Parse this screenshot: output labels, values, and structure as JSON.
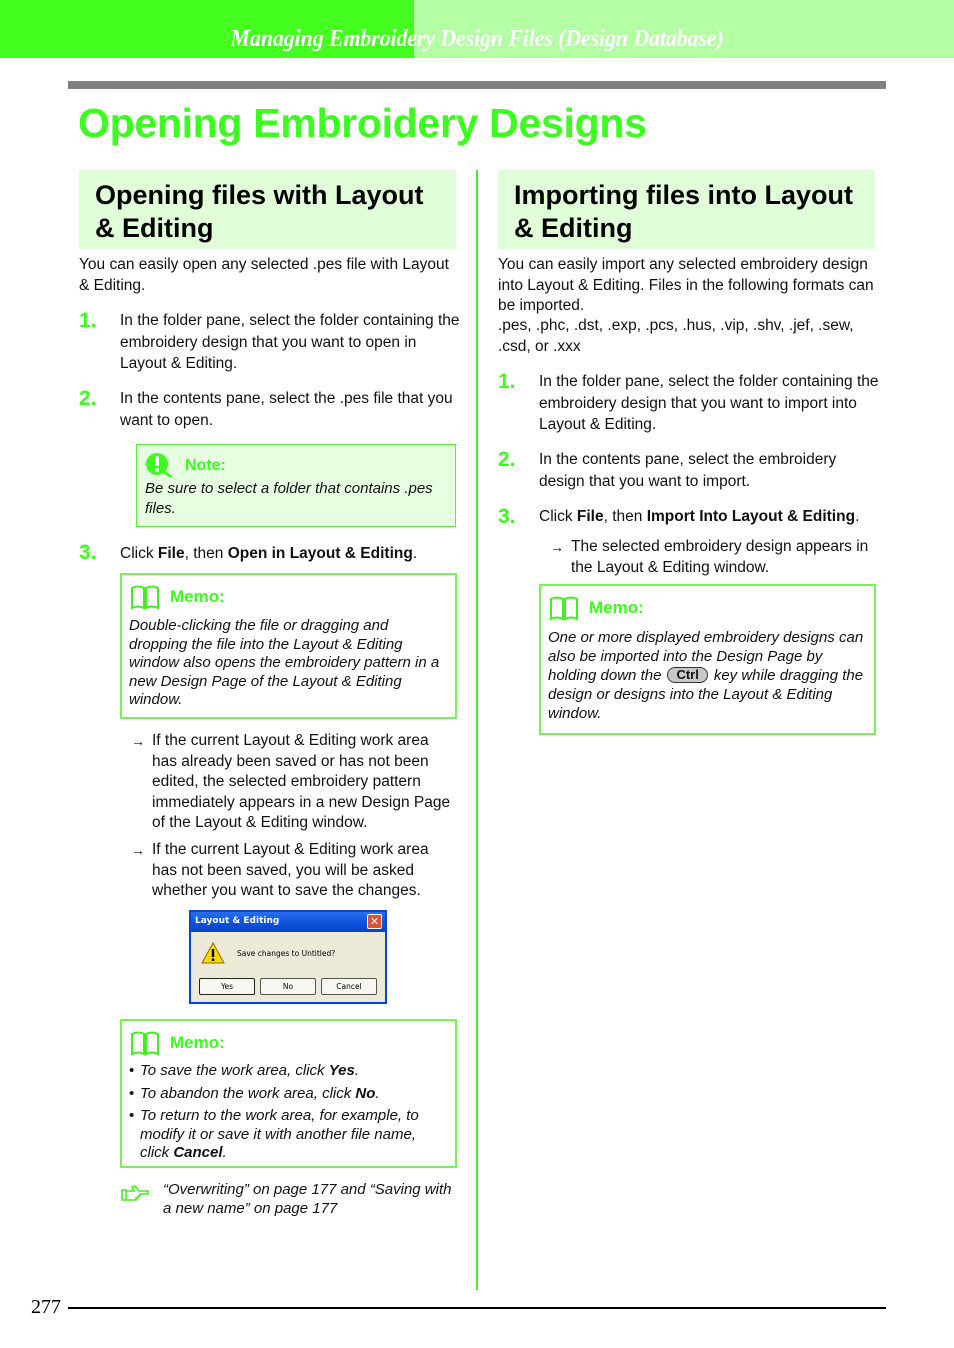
{
  "header": {
    "chapter_title": "Managing Embroidery Design Files (Design Database)",
    "colors": {
      "bright_green": "#44ff1f",
      "light_green": "#b4ffa4"
    }
  },
  "page_title": "Opening Embroidery Designs",
  "left": {
    "heading": "Opening files with Layout & Editing",
    "intro": "You can easily open any selected .pes file with Layout & Editing.",
    "steps": [
      {
        "num": "1.",
        "text": "In the folder pane, select the folder containing the embroidery design that you want to open in Layout & Editing."
      },
      {
        "num": "2.",
        "text": "In the contents pane, select the .pes file that you want to open."
      },
      {
        "num": "3.",
        "text_prefix": "Click ",
        "bold1": "File",
        "text_mid": ", then ",
        "bold2": "Open in Layout & Editing",
        "text_suffix": "."
      }
    ],
    "note": {
      "label": "Note:",
      "text": "Be sure to select a folder that contains .pes files."
    },
    "memo1": {
      "label": "Memo:",
      "text": "Double-clicking the file or dragging and dropping the file into the Layout & Editing window also opens the embroidery pattern in a new Design Page of the Layout & Editing window."
    },
    "results": [
      "If the current Layout & Editing work area has already been saved or has not been edited, the selected embroidery pattern immediately appears in a new Design Page of the Layout & Editing window.",
      "If the current Layout & Editing work area has not been saved, you will be asked whether you want to save the changes."
    ],
    "dialog": {
      "title": "Layout & Editing",
      "message": "Save changes to Untitled?",
      "buttons": [
        "Yes",
        "No",
        "Cancel"
      ]
    },
    "memo2": {
      "label": "Memo:",
      "bullets": [
        {
          "pre": "To save the work area, click ",
          "bold": "Yes",
          "post": "."
        },
        {
          "pre": "To abandon the work area, click ",
          "bold": "No",
          "post": "."
        },
        {
          "pre": "To return to the work area, for example, to modify it or save it with another file name, click ",
          "bold": "Cancel",
          "post": "."
        }
      ]
    },
    "reference": "“Overwriting” on page 177 and “Saving with a new name” on page 177"
  },
  "right": {
    "heading": "Importing files into Layout & Editing",
    "intro": "You can easily import any selected embroidery design into Layout & Editing. Files in the following formats can be imported.",
    "formats": ".pes, .phc, .dst, .exp, .pcs, .hus, .vip, .shv, .jef, .sew, .csd, or .xxx",
    "steps": [
      {
        "num": "1.",
        "text": "In the folder pane, select the folder containing the embroidery design that you want to import into Layout & Editing."
      },
      {
        "num": "2.",
        "text": "In the contents pane, select the embroidery design that you want to import."
      },
      {
        "num": "3.",
        "text_prefix": "Click ",
        "bold1": "File",
        "text_mid": ", then ",
        "bold2": "Import Into Layout & Editing",
        "text_suffix": "."
      }
    ],
    "result": "The selected embroidery design appears in the Layout & Editing window.",
    "memo": {
      "label": "Memo:",
      "text_before_key": "One or more displayed embroidery designs can also be imported into the Design Page by holding down the",
      "key": "Ctrl",
      "text_after_key": "key while dragging the design or designs into the Layout & Editing window."
    }
  },
  "footer": {
    "page_number": "277"
  }
}
